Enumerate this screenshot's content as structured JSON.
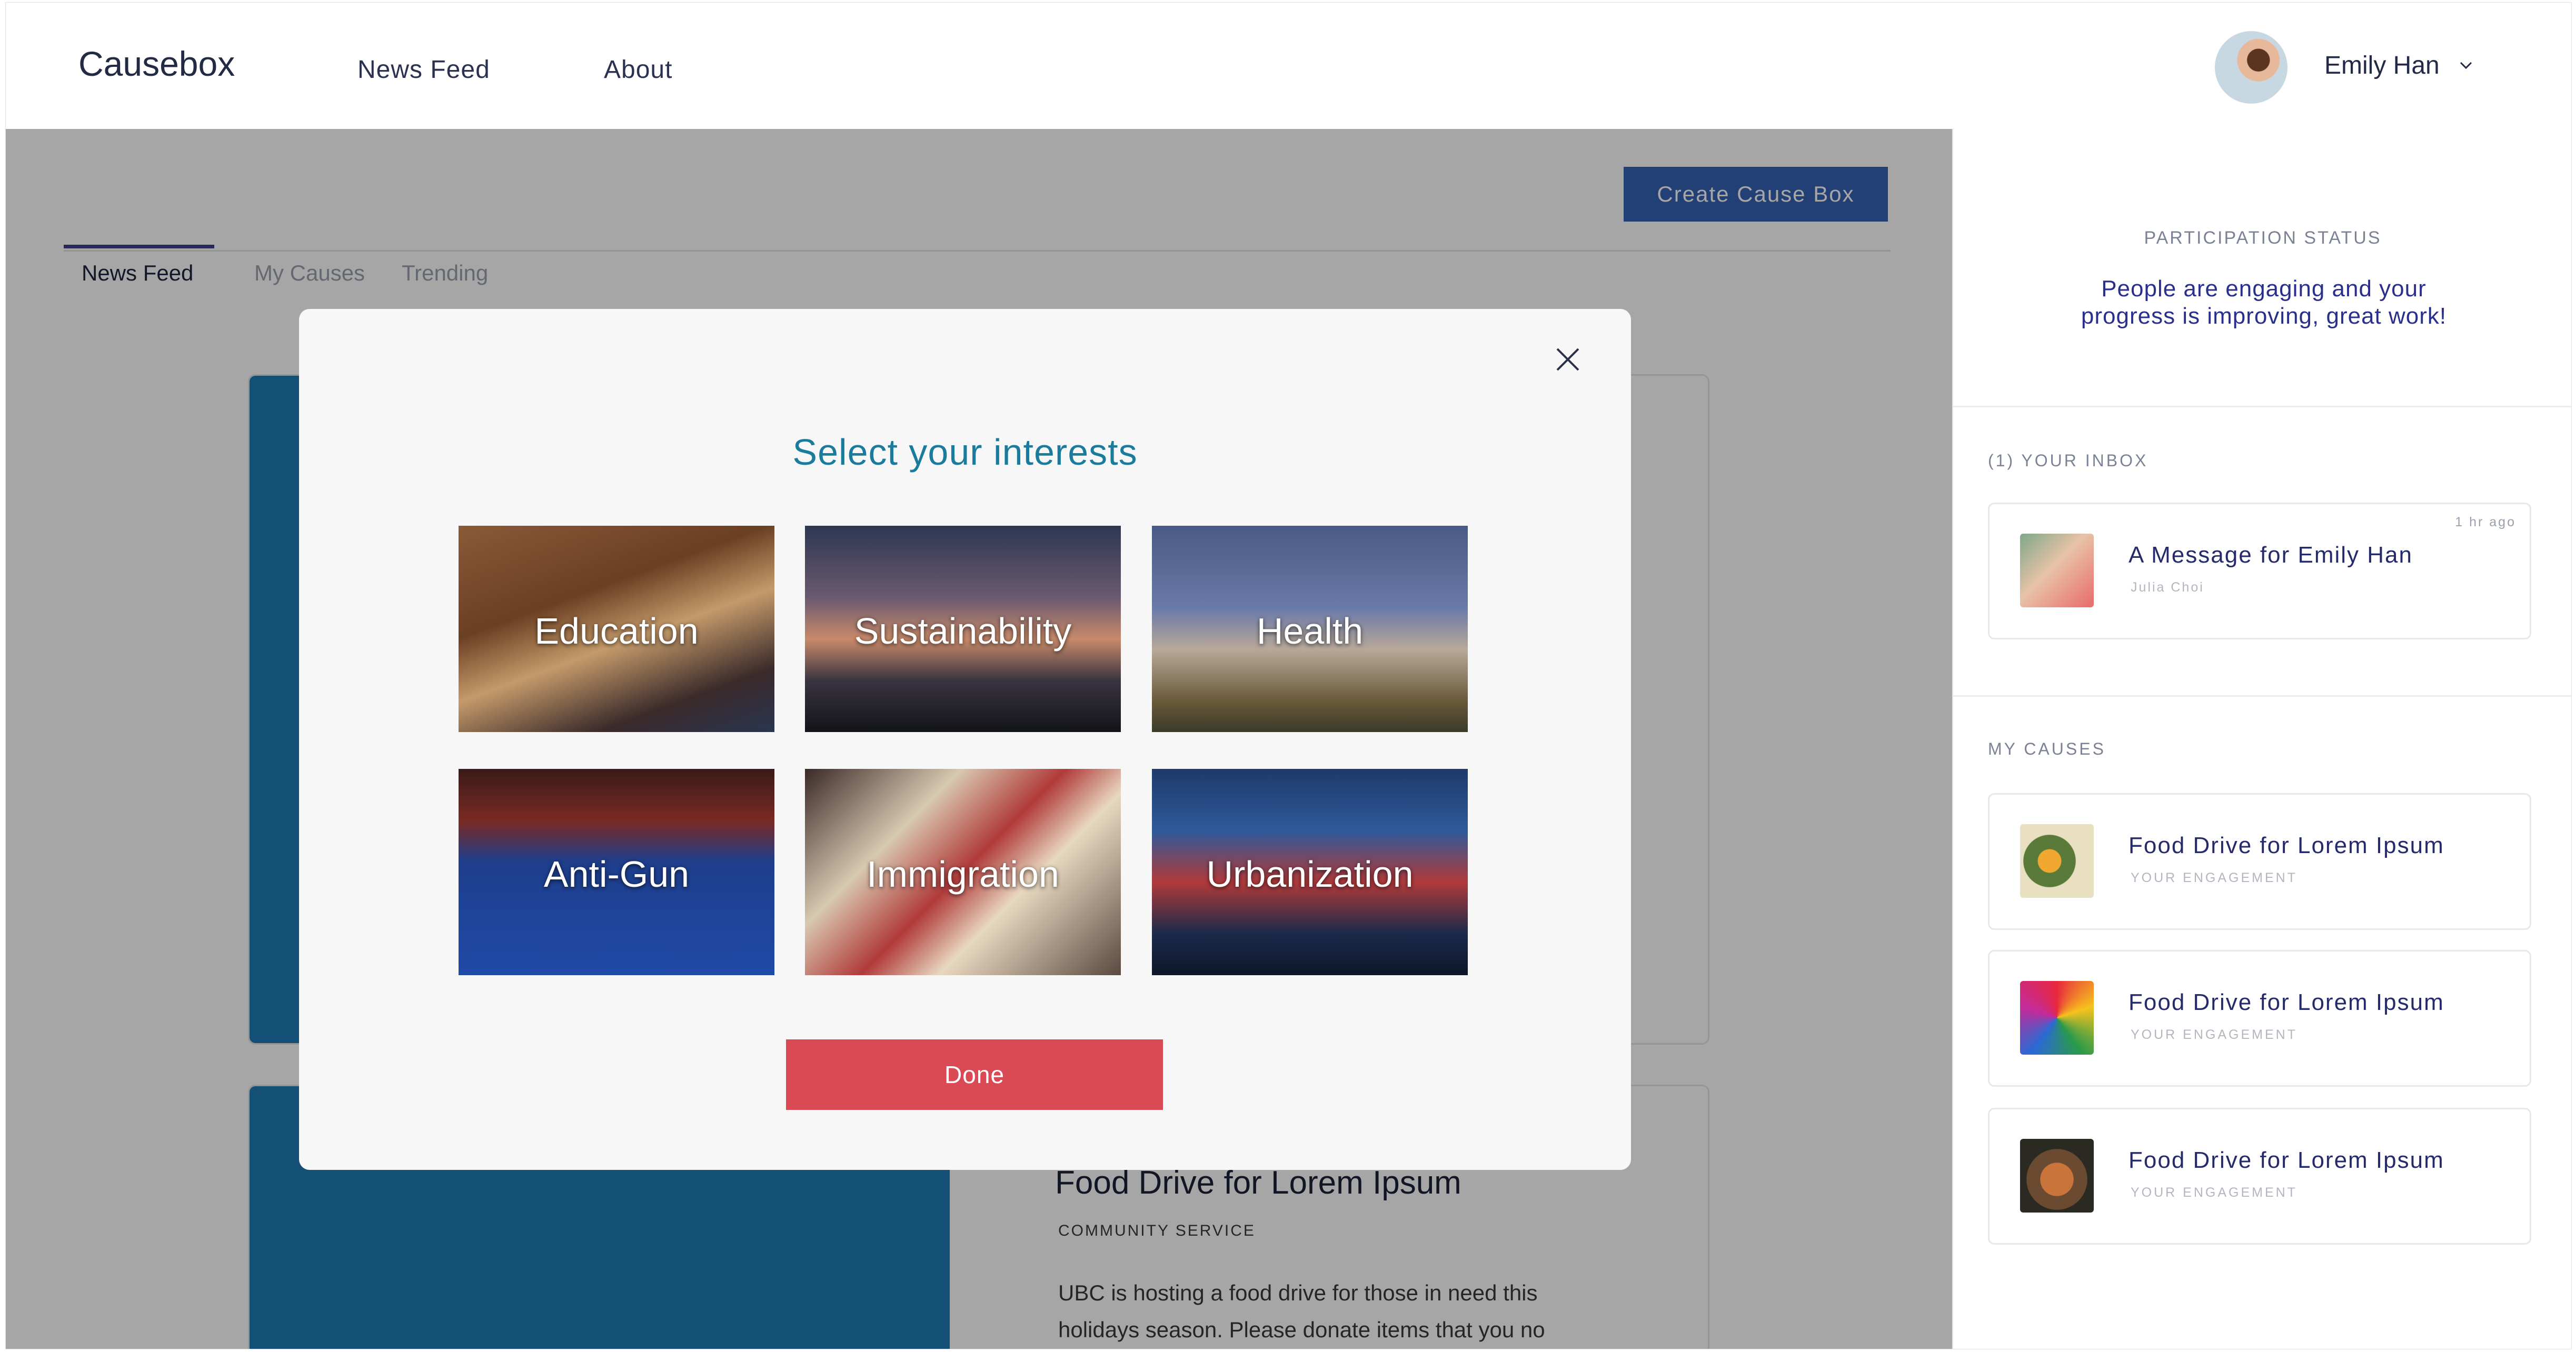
{
  "app": {
    "brand": "Causebox"
  },
  "topnav": {
    "links": [
      "News Feed",
      "About"
    ],
    "user_name": "Emily Han"
  },
  "main": {
    "tabs": [
      {
        "label": "News Feed",
        "active": true
      },
      {
        "label": "My Causes",
        "active": false
      },
      {
        "label": "Trending",
        "active": false
      }
    ],
    "create_button": "Create Cause Box",
    "card2": {
      "title": "Food Drive for Lorem Ipsum",
      "category": "COMMUNITY SERVICE",
      "description_line1": "UBC is hosting a food drive for those in need this",
      "description_line2": "holidays season. Please donate items that you no"
    }
  },
  "sidepanel": {
    "participation_label": "PARTICIPATION STATUS",
    "participation_line1": "People are engaging and your",
    "participation_line2": "progress is improving, great work!",
    "inbox_label": "(1)  YOUR INBOX",
    "inbox_message": {
      "title": "A Message for Emily Han",
      "sender": "Julia Choi",
      "time": "1 hr ago"
    },
    "causes_label": "MY CAUSES",
    "causes": [
      {
        "title": "Food Drive for Lorem Ipsum",
        "sub": "YOUR ENGAGEMENT"
      },
      {
        "title": "Food Drive for Lorem Ipsum",
        "sub": "YOUR ENGAGEMENT"
      },
      {
        "title": "Food Drive for Lorem Ipsum",
        "sub": "YOUR ENGAGEMENT"
      }
    ]
  },
  "modal": {
    "title": "Select your interests",
    "interests": [
      "Education",
      "Sustainability",
      "Health",
      "Anti-Gun",
      "Immigration",
      "Urbanization"
    ],
    "done_button": "Done"
  },
  "colors": {
    "accent_teal": "#1a7b9c",
    "done_red": "#d94a54",
    "create_blue": "#3563b6",
    "card_blue": "#1f7ab4"
  }
}
